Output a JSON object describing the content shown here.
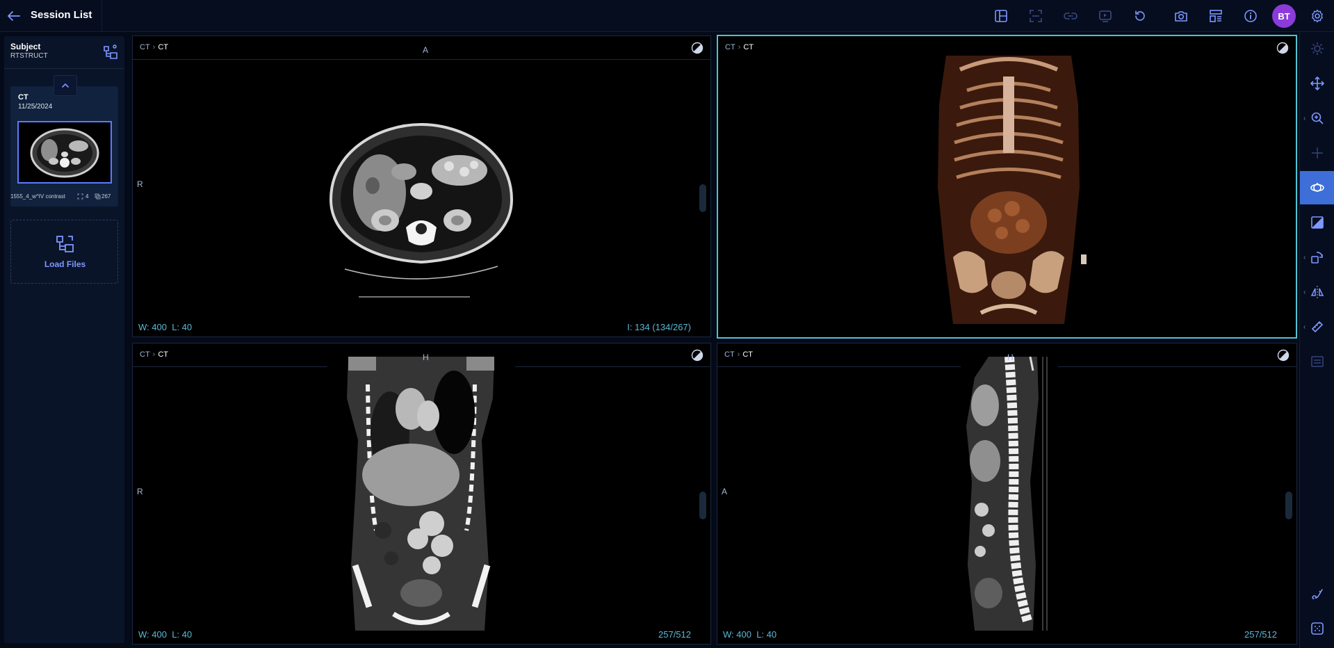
{
  "header": {
    "title": "Session List",
    "avatar_initials": "BT"
  },
  "sidebar": {
    "subject_name": "Subject",
    "subject_modality": "RTSTRUCT",
    "series": {
      "modality": "CT",
      "date": "11/25/2024",
      "description": "1555_4_w^IV contrast",
      "count_a": "4",
      "count_b": "267"
    },
    "load_files_label": "Load Files"
  },
  "viewports": [
    {
      "crumb_parent": "CT",
      "crumb_current": "CT",
      "orient_top": "A",
      "orient_left": "R",
      "window": "W: 400",
      "level": "L: 40",
      "info": "I: 134 (134/267)"
    },
    {
      "crumb_parent": "CT",
      "crumb_current": "CT"
    },
    {
      "crumb_parent": "CT",
      "crumb_current": "CT",
      "orient_top": "H",
      "orient_left": "R",
      "window": "W: 400",
      "level": "L: 40",
      "info": "257/512"
    },
    {
      "crumb_parent": "CT",
      "crumb_current": "CT",
      "orient_top": "H",
      "orient_left": "A",
      "window": "W: 400",
      "level": "L: 40",
      "info": "257/512"
    }
  ],
  "icons": {
    "back": "arrow-left-icon",
    "layout": "layout-grid-icon",
    "crosshair_frame": "frame-corners-icon",
    "link": "link-icon",
    "screen": "monitor-play-icon",
    "reset": "reset-rotate-icon",
    "capture": "camera-icon",
    "panels": "panels-icon",
    "info": "info-icon",
    "settings": "gear-icon"
  },
  "colors": {
    "accent": "#4fc3d3",
    "primary": "#5b7bff",
    "avatar": "#8c3bdb",
    "overlay_text": "#59b9d8"
  }
}
